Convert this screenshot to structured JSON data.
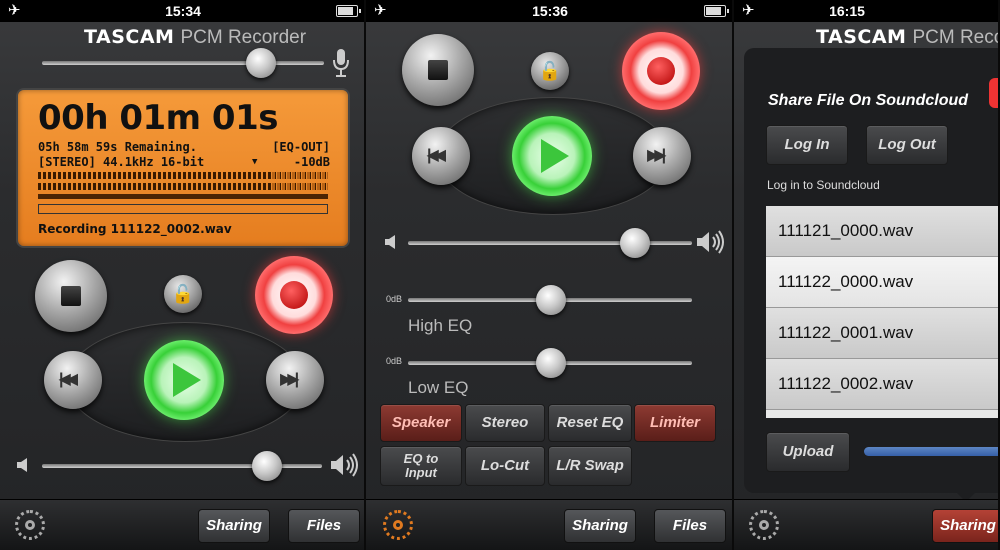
{
  "screens": [
    {
      "status": {
        "time": "15:34",
        "airplane": "✈"
      },
      "brand": {
        "name": "TASCAM",
        "product": "PCM Recorder"
      },
      "display": {
        "time": "00h 01m 01s",
        "remaining": "05h 58m 59s Remaining.",
        "eq_status": "[EQ-OUT]",
        "format": "[STEREO] 44.1kHz 16-bit",
        "level": "-10dB",
        "recording": "Recording 111122_0002.wav",
        "meter_level_top": 0.8,
        "meter_level_bottom": 0.8
      },
      "tabs": {
        "sharing": "Sharing",
        "files": "Files"
      }
    },
    {
      "status": {
        "time": "15:36",
        "airplane": "✈"
      },
      "eq": {
        "high_db": "0dB",
        "high_label": "High EQ",
        "low_db": "0dB",
        "low_label": "Low EQ"
      },
      "buttons": {
        "speaker": "Speaker",
        "stereo": "Stereo",
        "reset_eq": "Reset EQ",
        "limiter": "Limiter",
        "eq_to_input": "EQ to Input",
        "lo_cut": "Lo-Cut",
        "lr_swap": "L/R Swap"
      },
      "tabs": {
        "sharing": "Sharing",
        "files": "Files"
      }
    },
    {
      "status": {
        "time": "16:15",
        "airplane": "✈"
      },
      "brand": {
        "name": "TASCAM",
        "product": "PCM Recorder"
      },
      "share": {
        "title": "Share File On Soundcloud",
        "log_in": "Log In",
        "log_out": "Log Out",
        "login_label": "Log in to Soundcloud",
        "upload": "Upload"
      },
      "files": [
        "111121_0000.wav",
        "111122_0000.wav",
        "111122_0001.wav",
        "111122_0002.wav"
      ],
      "tabs": {
        "sharing": "Sharing"
      }
    }
  ],
  "colors": {
    "lcd": "#f2903a",
    "record": "#e23030",
    "play": "#3cc63c",
    "active_tab": "#9a3026",
    "progress": "#4a74b8"
  },
  "icons": {
    "airplane": "airplane-icon",
    "mic": "microphone-icon",
    "gear": "gear-icon",
    "lock": "unlock-icon",
    "speaker_low": "volume-low-icon",
    "speaker_high": "volume-high-icon"
  }
}
